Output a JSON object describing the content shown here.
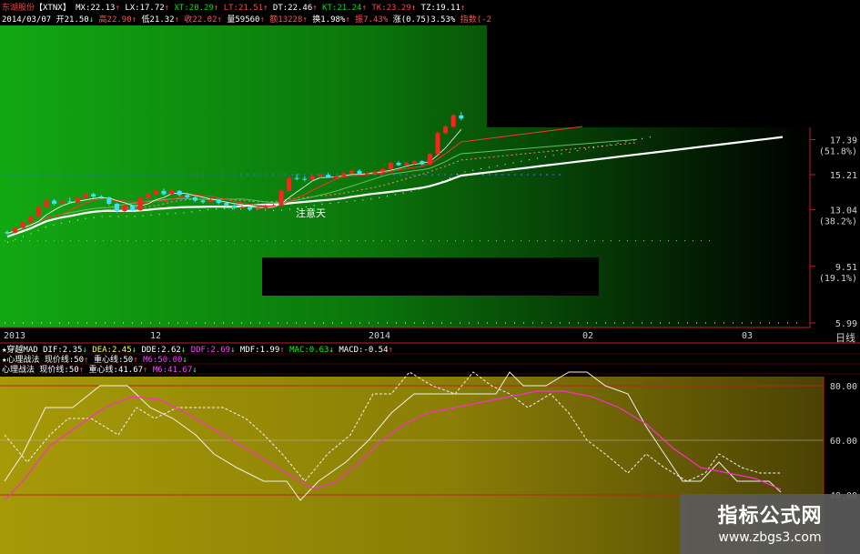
{
  "header": {
    "line1": {
      "name": "东湖股份",
      "code": "【XTNX】",
      "ma_items": [
        {
          "text": "MX:22.13",
          "arrow": "↑",
          "color": "#ffffff"
        },
        {
          "text": "LX:17.72",
          "arrow": "↑",
          "color": "#ffffff"
        },
        {
          "text": "XT:20.29",
          "arrow": "↑",
          "color": "#00e000"
        },
        {
          "text": "LT:21.51",
          "arrow": "↑",
          "color": "#ff4040"
        },
        {
          "text": "DT:22.46",
          "arrow": "↑",
          "color": "#ffffff"
        },
        {
          "text": "KT:21.24",
          "arrow": "↑",
          "color": "#00e000"
        },
        {
          "text": "TK:23.29",
          "arrow": "↑",
          "color": "#ff4040"
        },
        {
          "text": "TZ:19.11",
          "arrow": "↑",
          "color": "#ffffff"
        }
      ]
    },
    "line2": {
      "date": "2014/03/07",
      "items": [
        {
          "text": "开21.50",
          "arrow": "↓"
        },
        {
          "text": "高22.90",
          "arrow": "↑"
        },
        {
          "text": "低21.32",
          "arrow": "↑"
        },
        {
          "text": "收22.02",
          "arrow": "↑"
        },
        {
          "text": "量59560",
          "arrow": "↑"
        },
        {
          "text": "额13228",
          "arrow": "↑"
        },
        {
          "text": "换1.98%",
          "arrow": "↑"
        },
        {
          "text": "振7.43%",
          "arrow": ""
        },
        {
          "text": "涨(0.75)3.53%",
          "arrow": ""
        },
        {
          "text": "指数(-2",
          "arrow": ""
        }
      ]
    }
  },
  "price_axis": {
    "labels": [
      {
        "value": "17.39",
        "pct": "(51.8%)"
      },
      {
        "value": "15.21",
        "pct": ""
      },
      {
        "value": "13.04",
        "pct": "(38.2%)"
      },
      {
        "value": "9.51",
        "pct": "(19.1%)"
      },
      {
        "value": "5.99",
        "pct": ""
      }
    ]
  },
  "time_axis": {
    "labels": [
      "2013",
      "12",
      "2014",
      "02",
      "03"
    ],
    "period": "日线"
  },
  "annotation": {
    "text": "注意天"
  },
  "indicator_rows": [
    {
      "name": "★穿越MAD",
      "items": [
        {
          "text": "DIF:2.35",
          "arrow": "↓",
          "color": "#ffffff"
        },
        {
          "text": "DEA:2.45",
          "arrow": "↓",
          "color": "#ffff40"
        },
        {
          "text": "DDE:2.62",
          "arrow": "↓",
          "color": "#ffffff"
        },
        {
          "text": "DDF:2.69",
          "arrow": "↓",
          "color": "#ff40ff"
        },
        {
          "text": "MDF:1.99",
          "arrow": "↑",
          "color": "#ffffff"
        },
        {
          "text": "MAC:0.63",
          "arrow": "↓",
          "color": "#00ff00"
        },
        {
          "text": "MACD:-0.54",
          "arrow": "↑",
          "color": "#ffffff"
        }
      ]
    },
    {
      "name": "★心理战法",
      "items": [
        {
          "text": "现价线:50",
          "arrow": "↑",
          "color": "#ffffff"
        },
        {
          "text": "重心线:50",
          "arrow": "↑",
          "color": "#ffffff"
        },
        {
          "text": "M6:50.00",
          "arrow": "↓",
          "color": "#ff40ff"
        }
      ]
    },
    {
      "name": "心理战法",
      "items": [
        {
          "text": "现价线:50",
          "arrow": "↑",
          "color": "#ffffff"
        },
        {
          "text": "重心线:41.67",
          "arrow": "↑",
          "color": "#ffffff"
        },
        {
          "text": "M6:41.67",
          "arrow": "↓",
          "color": "#ff40ff"
        }
      ]
    }
  ],
  "colors": {
    "up": "#ff2020",
    "down": "#40e0ff",
    "ma_white": "#ffffff",
    "ma_red": "#ff3030",
    "ma_green": "#60c060",
    "ma_pink": "#ff8080",
    "indicator_magenta": "#ff2bd0"
  },
  "watermark": {
    "main": "指标公式网",
    "url": "www.zbgs3.com"
  },
  "chart_data": [
    {
      "type": "candlestick",
      "title": "",
      "ylim": [
        5.99,
        19.0
      ],
      "y_ticks": [
        17.39,
        15.21,
        13.04,
        9.51,
        5.99
      ],
      "grid": false,
      "candles": [
        [
          11.65,
          11.75,
          11.5,
          11.55
        ],
        [
          11.6,
          11.95,
          11.55,
          11.9
        ],
        [
          11.9,
          12.3,
          11.85,
          12.25
        ],
        [
          12.25,
          12.65,
          12.2,
          12.6
        ],
        [
          12.6,
          13.3,
          12.55,
          13.2
        ],
        [
          13.2,
          13.75,
          13.1,
          13.6
        ],
        [
          13.6,
          13.7,
          13.3,
          13.4
        ],
        [
          13.4,
          13.7,
          13.35,
          13.55
        ],
        [
          13.55,
          13.8,
          13.4,
          13.5
        ],
        [
          13.5,
          13.9,
          13.45,
          13.75
        ],
        [
          13.75,
          14.1,
          13.7,
          14.0
        ],
        [
          14.0,
          14.1,
          13.75,
          13.85
        ],
        [
          13.85,
          13.95,
          13.7,
          13.8
        ],
        [
          13.8,
          13.85,
          13.3,
          13.4
        ],
        [
          13.4,
          13.45,
          12.85,
          12.95
        ],
        [
          12.95,
          13.4,
          12.9,
          13.3
        ],
        [
          13.3,
          13.35,
          12.9,
          13.0
        ],
        [
          13.0,
          13.85,
          12.95,
          13.75
        ],
        [
          13.75,
          14.1,
          13.7,
          14.0
        ],
        [
          14.0,
          14.3,
          13.95,
          14.2
        ],
        [
          14.2,
          14.35,
          13.9,
          14.0
        ],
        [
          14.0,
          14.3,
          13.95,
          14.2
        ],
        [
          14.2,
          14.25,
          13.85,
          13.95
        ],
        [
          13.95,
          14.0,
          13.7,
          13.8
        ],
        [
          13.8,
          13.85,
          13.5,
          13.6
        ],
        [
          13.6,
          13.7,
          13.4,
          13.5
        ],
        [
          13.5,
          13.75,
          13.45,
          13.65
        ],
        [
          13.65,
          13.7,
          13.35,
          13.45
        ],
        [
          13.45,
          13.5,
          13.2,
          13.3
        ],
        [
          13.3,
          13.35,
          13.05,
          13.15
        ],
        [
          13.15,
          13.3,
          13.1,
          13.2
        ],
        [
          13.2,
          13.25,
          12.95,
          13.05
        ],
        [
          13.05,
          13.25,
          12.95,
          13.15
        ],
        [
          13.15,
          13.35,
          13.05,
          13.25
        ],
        [
          13.25,
          13.4,
          13.2,
          13.3
        ],
        [
          13.3,
          14.3,
          13.25,
          14.2
        ],
        [
          14.2,
          15.1,
          14.15,
          15.0
        ],
        [
          15.0,
          15.25,
          14.85,
          14.95
        ],
        [
          14.95,
          15.1,
          14.8,
          14.9
        ],
        [
          14.9,
          15.2,
          14.85,
          15.1
        ],
        [
          15.1,
          15.3,
          15.0,
          15.2
        ],
        [
          15.2,
          15.35,
          15.0,
          15.05
        ],
        [
          15.05,
          15.15,
          14.95,
          15.1
        ],
        [
          15.1,
          15.4,
          15.05,
          15.3
        ],
        [
          15.3,
          15.55,
          15.25,
          15.45
        ],
        [
          15.45,
          15.55,
          15.2,
          15.25
        ],
        [
          15.25,
          15.4,
          15.15,
          15.3
        ],
        [
          15.3,
          15.45,
          15.2,
          15.4
        ],
        [
          15.4,
          15.65,
          15.35,
          15.55
        ],
        [
          15.55,
          16.0,
          15.5,
          15.95
        ],
        [
          15.95,
          16.05,
          15.75,
          15.8
        ],
        [
          15.8,
          16.0,
          15.75,
          15.95
        ],
        [
          15.95,
          16.1,
          15.85,
          16.05
        ],
        [
          16.05,
          16.1,
          15.8,
          15.85
        ],
        [
          15.85,
          16.55,
          15.8,
          16.5
        ],
        [
          16.5,
          17.9,
          16.45,
          17.8
        ],
        [
          17.8,
          18.3,
          17.7,
          18.2
        ],
        [
          18.2,
          19.0,
          18.1,
          18.9
        ],
        [
          18.9,
          19.1,
          18.6,
          18.7
        ]
      ]
    },
    {
      "type": "line",
      "title": "",
      "ylim": [
        35,
        90
      ],
      "y_ticks": [
        80.0,
        60.0,
        40.0
      ],
      "series": []
    }
  ]
}
